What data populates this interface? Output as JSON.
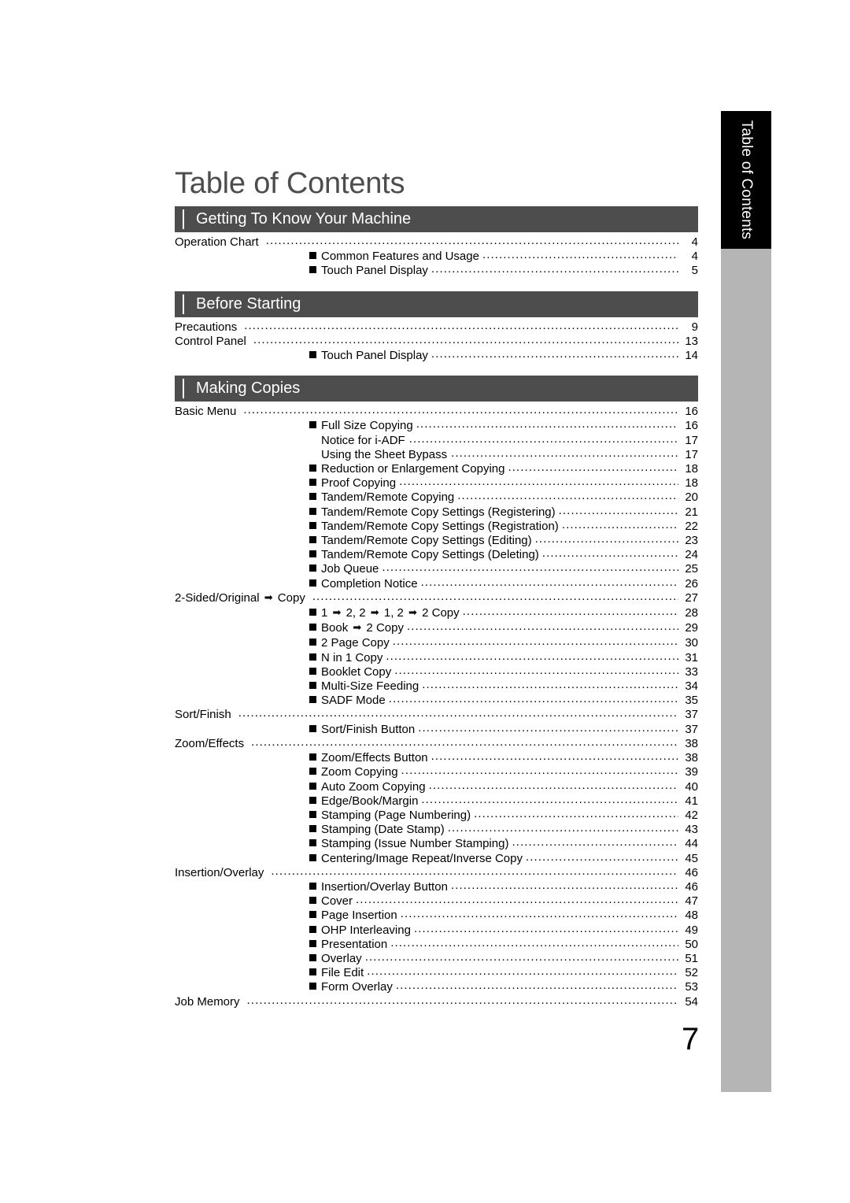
{
  "side_tab": {
    "label": "Table of Contents"
  },
  "page_title": "Table of Contents",
  "folio": "7",
  "sections": [
    {
      "title": "Getting To Know Your Machine",
      "entries": [
        {
          "level": 1,
          "label": "Operation Chart",
          "page": "4"
        },
        {
          "level": 2,
          "label": "Common Features and Usage",
          "page": "4"
        },
        {
          "level": 2,
          "label": "Touch Panel Display",
          "page": "5"
        }
      ]
    },
    {
      "title": "Before Starting",
      "entries": [
        {
          "level": 1,
          "label": "Precautions",
          "page": "9"
        },
        {
          "level": 1,
          "label": "Control Panel",
          "page": "13"
        },
        {
          "level": 2,
          "label": "Touch Panel Display",
          "page": "14"
        }
      ]
    },
    {
      "title": "Making Copies",
      "entries": [
        {
          "level": 1,
          "label": "Basic Menu",
          "page": "16"
        },
        {
          "level": 2,
          "label": "Full Size Copying",
          "page": "16"
        },
        {
          "level": 3,
          "label": "Notice for i-ADF",
          "page": "17"
        },
        {
          "level": 3,
          "label": "Using the Sheet Bypass",
          "page": "17"
        },
        {
          "level": 2,
          "label": "Reduction or Enlargement Copying",
          "page": "18"
        },
        {
          "level": 2,
          "label": "Proof Copying",
          "page": "18"
        },
        {
          "level": 2,
          "label": "Tandem/Remote Copying",
          "page": "20"
        },
        {
          "level": 2,
          "label": "Tandem/Remote Copy Settings (Registering)",
          "page": "21"
        },
        {
          "level": 2,
          "label": "Tandem/Remote Copy Settings (Registration)",
          "page": "22"
        },
        {
          "level": 2,
          "label": "Tandem/Remote Copy Settings (Editing)",
          "page": "23"
        },
        {
          "level": 2,
          "label": "Tandem/Remote Copy Settings (Deleting)",
          "page": "24"
        },
        {
          "level": 2,
          "label": "Job Queue",
          "page": "25"
        },
        {
          "level": 2,
          "label": "Completion Notice",
          "page": "26"
        },
        {
          "level": 1,
          "label": "2-Sided/Original ➡ Copy",
          "page": "27"
        },
        {
          "level": 2,
          "label": "1 ➡ 2, 2 ➡ 1, 2 ➡ 2 Copy",
          "page": "28"
        },
        {
          "level": 2,
          "label": "Book ➡ 2 Copy",
          "page": "29"
        },
        {
          "level": 2,
          "label": "2 Page Copy",
          "page": "30"
        },
        {
          "level": 2,
          "label": "N in 1 Copy",
          "page": "31"
        },
        {
          "level": 2,
          "label": "Booklet Copy",
          "page": "33"
        },
        {
          "level": 2,
          "label": "Multi-Size Feeding",
          "page": "34"
        },
        {
          "level": 2,
          "label": "SADF Mode",
          "page": "35"
        },
        {
          "level": 1,
          "label": "Sort/Finish",
          "page": "37"
        },
        {
          "level": 2,
          "label": "Sort/Finish Button",
          "page": "37"
        },
        {
          "level": 1,
          "label": "Zoom/Effects",
          "page": "38"
        },
        {
          "level": 2,
          "label": "Zoom/Effects Button",
          "page": "38"
        },
        {
          "level": 2,
          "label": "Zoom Copying",
          "page": "39"
        },
        {
          "level": 2,
          "label": "Auto Zoom Copying",
          "page": "40"
        },
        {
          "level": 2,
          "label": "Edge/Book/Margin",
          "page": "41"
        },
        {
          "level": 2,
          "label": "Stamping (Page Numbering)",
          "page": "42"
        },
        {
          "level": 2,
          "label": "Stamping (Date Stamp)",
          "page": "43"
        },
        {
          "level": 2,
          "label": "Stamping (Issue Number Stamping)",
          "page": "44"
        },
        {
          "level": 2,
          "label": "Centering/Image Repeat/Inverse Copy",
          "page": "45"
        },
        {
          "level": 1,
          "label": "Insertion/Overlay",
          "page": "46"
        },
        {
          "level": 2,
          "label": "Insertion/Overlay Button",
          "page": "46"
        },
        {
          "level": 2,
          "label": "Cover",
          "page": "47"
        },
        {
          "level": 2,
          "label": "Page Insertion",
          "page": "48"
        },
        {
          "level": 2,
          "label": "OHP Interleaving",
          "page": "49"
        },
        {
          "level": 2,
          "label": "Presentation",
          "page": "50"
        },
        {
          "level": 2,
          "label": "Overlay",
          "page": "51"
        },
        {
          "level": 2,
          "label": "File Edit",
          "page": "52"
        },
        {
          "level": 2,
          "label": "Form Overlay",
          "page": "53"
        },
        {
          "level": 1,
          "label": "Job Memory",
          "page": "54"
        }
      ]
    }
  ],
  "colors": {
    "section_bar": "#4d4d4d",
    "title": "#4d4d4d",
    "side_tab": "#000000",
    "side_strip": "#b5b5b5"
  }
}
